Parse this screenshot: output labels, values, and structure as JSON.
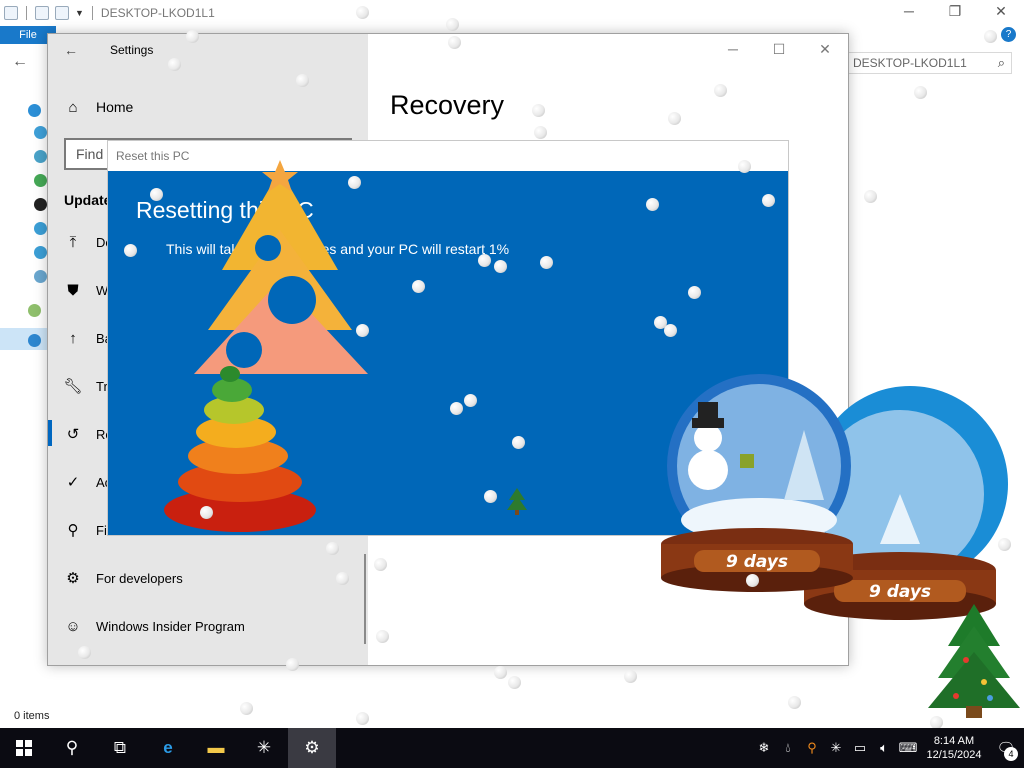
{
  "explorer": {
    "title": "DESKTOP-LKOD1L1",
    "ribbon_file": "File",
    "search_placeholder": "h DESKTOP-LKOD1L1",
    "status": "0 items"
  },
  "settings": {
    "app_title": "Settings",
    "page_title": "Recovery",
    "home_label": "Home",
    "find_placeholder": "Find",
    "section_label": "Update",
    "items": [
      {
        "label": "De",
        "icon": "upload-icon"
      },
      {
        "label": "W",
        "icon": "shield-icon"
      },
      {
        "label": "Ba",
        "icon": "backup-icon"
      },
      {
        "label": "Tr",
        "icon": "wrench-icon"
      },
      {
        "label": "Re",
        "icon": "history-icon"
      },
      {
        "label": "Ac",
        "icon": "check-circle-icon"
      },
      {
        "label": "Fi",
        "icon": "person-icon"
      },
      {
        "label": "For developers",
        "icon": "developer-icon"
      },
      {
        "label": "Windows Insider Program",
        "icon": "insider-icon"
      }
    ]
  },
  "reset": {
    "window_title": "Reset this PC",
    "heading": "Resetting this PC",
    "message": "This will take a few minutes and your PC will restart 1%"
  },
  "decor": {
    "globe_label_1": "9 days",
    "globe_label_2": "9 days"
  },
  "taskbar": {
    "time": "8:14 AM",
    "date": "12/15/2024",
    "notification_count": "4"
  },
  "colors": {
    "accent": "#0067b8",
    "taskbar": "#0b0b12",
    "settings_sidebar": "#e6e6e6"
  }
}
